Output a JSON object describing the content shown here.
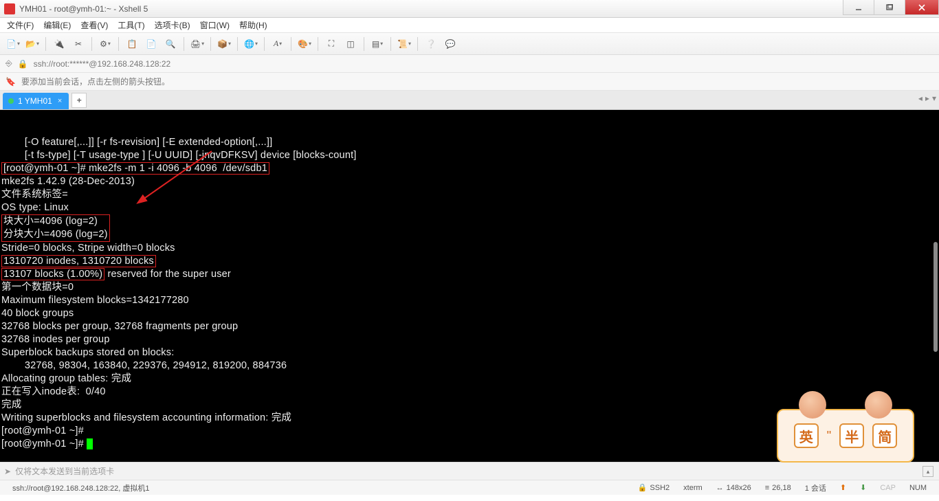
{
  "window": {
    "title": "YMH01 - root@ymh-01:~ - Xshell 5"
  },
  "menus": {
    "file": "文件(F)",
    "edit": "编辑(E)",
    "view": "查看(V)",
    "tools": "工具(T)",
    "tabs": "选项卡(B)",
    "window": "窗口(W)",
    "help": "帮助(H)"
  },
  "address": {
    "url": "ssh://root:******@192.168.248.128:22"
  },
  "hint": {
    "text": "要添加当前会话，点击左侧的箭头按钮。"
  },
  "tab": {
    "label": "1 YMH01"
  },
  "terminal": {
    "lines_pre": [
      "        [-O feature[,...]] [-r fs-revision] [-E extended-option[,...]]",
      "        [-t fs-type] [-T usage-type ] [-U UUID] [-jnqvDFKSV] device [blocks-count]"
    ],
    "cmd_prompt": "[root@ymh-01 ~]# mke2fs -m 1 -i 4096 -b 4096  /dev/sdb1",
    "lines_a": [
      "mke2fs 1.42.9 (28-Dec-2013)",
      "文件系统标签=",
      "OS type: Linux"
    ],
    "box_bs1": "块大小=4096 (log=2)",
    "box_bs2": "分块大小=4096 (log=2)",
    "lines_b": [
      "Stride=0 blocks, Stripe width=0 blocks"
    ],
    "box_inodes": "1310720 inodes, 1310720 blocks",
    "box_reserved": "13107 blocks (1.00%)",
    "reserved_tail": " reserved for the super user",
    "lines_c": [
      "第一个数据块=0",
      "Maximum filesystem blocks=1342177280",
      "40 block groups",
      "32768 blocks per group, 32768 fragments per group",
      "32768 inodes per group",
      "Superblock backups stored on blocks:",
      "        32768, 98304, 163840, 229376, 294912, 819200, 884736",
      "",
      "Allocating group tables: 完成",
      "正在写入inode表:  0/40",
      "完成",
      "Writing superblocks and filesystem accounting information: 完成",
      "",
      "[root@ymh-01 ~]#"
    ],
    "prompt_last": "[root@ymh-01 ~]# "
  },
  "sendbar": {
    "placeholder": "仅将文本发送到当前选项卡"
  },
  "status": {
    "conn": "ssh://root@192.168.248.128:22, 虚拟机1",
    "ssh": "SSH2",
    "term": "xterm",
    "size": "148x26",
    "pos": "26,18",
    "sess": "1 会话",
    "cap": "CAP",
    "num": "NUM"
  },
  "ime": {
    "c1": "英",
    "sep": "\"",
    "c2": "半",
    "c3": "简"
  }
}
